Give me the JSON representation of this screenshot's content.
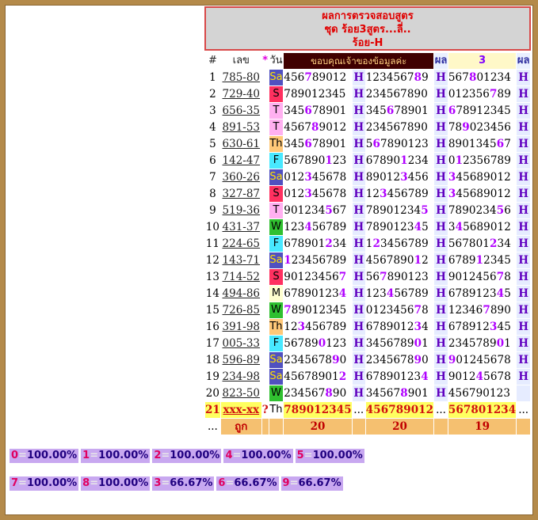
{
  "title": {
    "line1": "ผลการตรวจสอบสูตร",
    "line2": "ชุด ร้อย3สูตร...ลี่..",
    "line3": "ร้อย-H"
  },
  "headers": {
    "num": "#",
    "pair": "เลข",
    "star": "*",
    "day": "วัน",
    "thanks": "ขอบคุณเจ้าของข้อมูลค่ะ",
    "result": "ผล",
    "three": "3",
    "result2": "ผล"
  },
  "rows": [
    {
      "n": "1",
      "pair": "785-80",
      "day": "Sa",
      "s1": "456789012",
      "h1": "H",
      "s2": "123456789",
      "h2": "H",
      "s3": "567801234",
      "h3": "H",
      "hl1": "7",
      "hl2": "8",
      "hl3": "8"
    },
    {
      "n": "2",
      "pair": "729-40",
      "day": "S",
      "s1": "789012345",
      "h1": "H",
      "s2": "234567890",
      "h2": "H",
      "s3": "012356789",
      "h3": "H",
      "hl1": "",
      "hl2": "",
      "hl3": "7"
    },
    {
      "n": "3",
      "pair": "656-35",
      "day": "T",
      "s1": "345678901",
      "h1": "H",
      "s2": "345678901",
      "h2": "H",
      "s3": "678912345",
      "h3": "H",
      "hl1": "6",
      "hl2": "6",
      "hl3": "6"
    },
    {
      "n": "4",
      "pair": "891-53",
      "day": "T",
      "s1": "456789012",
      "h1": "H",
      "s2": "234567890",
      "h2": "H",
      "s3": "789023456",
      "h3": "H",
      "hl1": "8",
      "hl2": "",
      "hl3": "9"
    },
    {
      "n": "5",
      "pair": "630-61",
      "day": "Th",
      "s1": "345678901",
      "h1": "H",
      "s2": "567890123",
      "h2": "H",
      "s3": "890134567",
      "h3": "H",
      "hl1": "6",
      "hl2": "6",
      "hl3": "6"
    },
    {
      "n": "6",
      "pair": "142-47",
      "day": "F",
      "s1": "567890123",
      "h1": "H",
      "s2": "678901234",
      "h2": "H",
      "s3": "012356789",
      "h3": "H",
      "hl1": "1",
      "hl2": "1",
      "hl3": "1"
    },
    {
      "n": "7",
      "pair": "360-26",
      "day": "Sa",
      "s1": "012345678",
      "h1": "H",
      "s2": "890123456",
      "h2": "H",
      "s3": "345689012",
      "h3": "H",
      "hl1": "3",
      "hl2": "3",
      "hl3": "3"
    },
    {
      "n": "8",
      "pair": "327-87",
      "day": "S",
      "s1": "012345678",
      "h1": "H",
      "s2": "123456789",
      "h2": "H",
      "s3": "345689012",
      "h3": "H",
      "hl1": "3",
      "hl2": "3",
      "hl3": "3"
    },
    {
      "n": "9",
      "pair": "519-36",
      "day": "T",
      "s1": "901234567",
      "h1": "H",
      "s2": "789012345",
      "h2": "H",
      "s3": "789023456",
      "h3": "H",
      "hl1": "5",
      "hl2": "5",
      "hl3": "5"
    },
    {
      "n": "10",
      "pair": "431-37",
      "day": "W",
      "s1": "123456789",
      "h1": "H",
      "s2": "789012345",
      "h2": "H",
      "s3": "345689012",
      "h3": "H",
      "hl1": "4",
      "hl2": "4",
      "hl3": "4"
    },
    {
      "n": "11",
      "pair": "224-65",
      "day": "F",
      "s1": "678901234",
      "h1": "H",
      "s2": "123456789",
      "h2": "H",
      "s3": "567801234",
      "h3": "H",
      "hl1": "2",
      "hl2": "2",
      "hl3": "2"
    },
    {
      "n": "12",
      "pair": "143-71",
      "day": "Sa",
      "s1": "123456789",
      "h1": "H",
      "s2": "456789012",
      "h2": "H",
      "s3": "678912345",
      "h3": "H",
      "hl1": "1",
      "hl2": "1",
      "hl3": "1"
    },
    {
      "n": "13",
      "pair": "714-52",
      "day": "S",
      "s1": "901234567",
      "h1": "H",
      "s2": "567890123",
      "h2": "H",
      "s3": "901245678",
      "h3": "H",
      "hl1": "7",
      "hl2": "7",
      "hl3": "7"
    },
    {
      "n": "14",
      "pair": "494-86",
      "day": "M",
      "s1": "678901234",
      "h1": "H",
      "s2": "123456789",
      "h2": "H",
      "s3": "678912345",
      "h3": "H",
      "hl1": "4",
      "hl2": "4",
      "hl3": "4"
    },
    {
      "n": "15",
      "pair": "726-85",
      "day": "W",
      "s1": "789012345",
      "h1": "H",
      "s2": "012345678",
      "h2": "H",
      "s3": "123467890",
      "h3": "H",
      "hl1": "7",
      "hl2": "7",
      "hl3": "7"
    },
    {
      "n": "16",
      "pair": "391-98",
      "day": "Th",
      "s1": "123456789",
      "h1": "H",
      "s2": "678901234",
      "h2": "H",
      "s3": "678912345",
      "h3": "H",
      "hl1": "3",
      "hl2": "3",
      "hl3": "3"
    },
    {
      "n": "17",
      "pair": "005-33",
      "day": "F",
      "s1": "567890123",
      "h1": "H",
      "s2": "345678901",
      "h2": "H",
      "s3": "234578901",
      "h3": "H",
      "hl1": "0",
      "hl2": "0",
      "hl3": "0"
    },
    {
      "n": "18",
      "pair": "596-89",
      "day": "Sa",
      "s1": "234567890",
      "h1": "H",
      "s2": "234567890",
      "h2": "H",
      "s3": "901245678",
      "h3": "H",
      "hl1": "9",
      "hl2": "9",
      "hl3": "9"
    },
    {
      "n": "19",
      "pair": "234-98",
      "day": "Sa",
      "s1": "456789012",
      "h1": "H",
      "s2": "678901234",
      "h2": "H",
      "s3": "901245678",
      "h3": "H",
      "hl1": "2",
      "hl2": "4",
      "hl3": "4"
    },
    {
      "n": "20",
      "pair": "823-50",
      "day": "W",
      "s1": "234567890",
      "h1": "H",
      "s2": "345678901",
      "h2": "H",
      "s3": "456790123",
      "h3": "",
      "hl1": "8",
      "hl2": "8",
      "hl3": ""
    }
  ],
  "next_row": {
    "n": "21",
    "pair": "xxx-xx",
    "q": "?",
    "day": "Th",
    "s1": "789012345",
    "s2": "456789012",
    "s3": "567801234",
    "dots": "..."
  },
  "footer": {
    "dots": "...",
    "label": "ถูก",
    "c1": "20",
    "c2": "20",
    "c3": "19"
  },
  "stats_row1": [
    {
      "digit": "0",
      "eq": "=",
      "pct": "100.00%"
    },
    {
      "digit": "1",
      "eq": "=",
      "pct": "100.00%"
    },
    {
      "digit": "2",
      "eq": "=",
      "pct": "100.00%"
    },
    {
      "digit": "4",
      "eq": "=",
      "pct": "100.00%"
    },
    {
      "digit": "5",
      "eq": "=",
      "pct": "100.00%"
    }
  ],
  "stats_row2": [
    {
      "digit": "7",
      "eq": "=",
      "pct": "100.00%"
    },
    {
      "digit": "8",
      "eq": "=",
      "pct": "100.00%"
    },
    {
      "digit": "3",
      "eq": "=",
      "pct": "66.67%"
    },
    {
      "digit": "6",
      "eq": "=",
      "pct": "66.67%"
    },
    {
      "digit": "9",
      "eq": "=",
      "pct": "66.67%"
    }
  ]
}
